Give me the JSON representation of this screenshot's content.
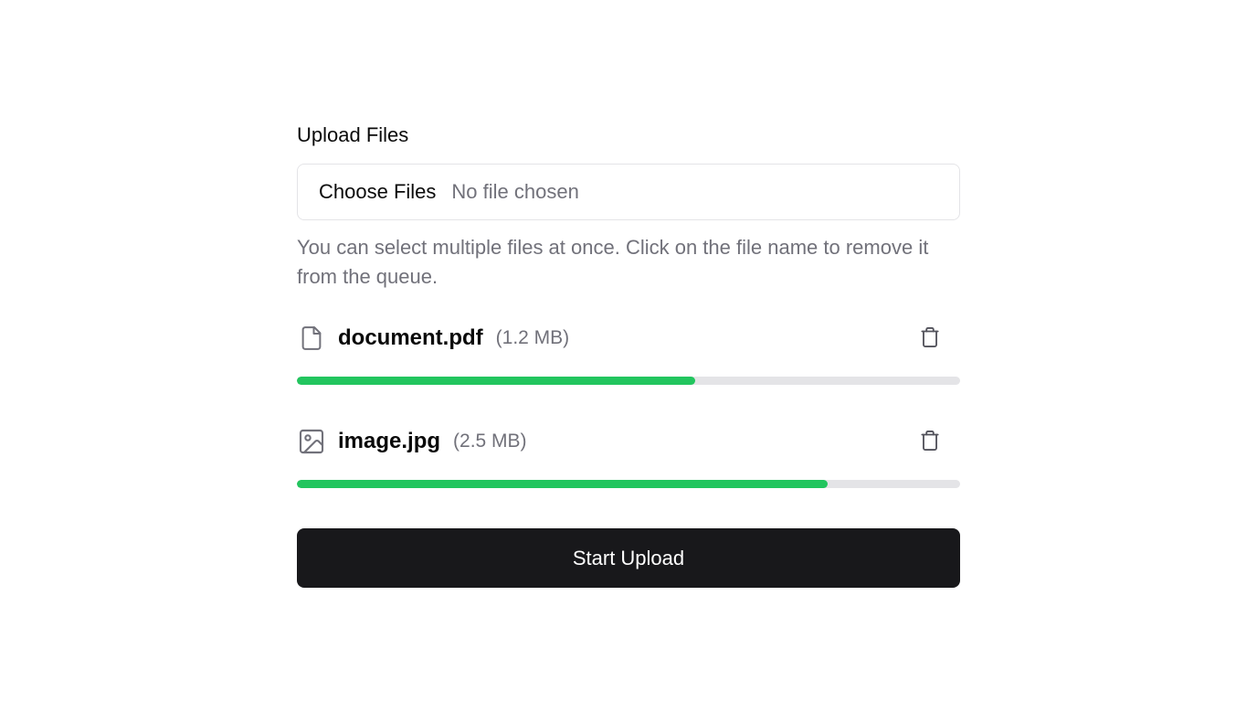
{
  "uploader": {
    "title": "Upload Files",
    "choose_label": "Choose Files",
    "no_file_text": "No file chosen",
    "help_text": "You can select multiple files at once. Click on the file name to remove it from the queue.",
    "files": [
      {
        "name": "document.pdf",
        "size": "(1.2 MB)",
        "icon": "file-icon",
        "progress": 0.6
      },
      {
        "name": "image.jpg",
        "size": "(2.5 MB)",
        "icon": "image-icon",
        "progress": 0.8
      }
    ],
    "start_label": "Start Upload"
  },
  "colors": {
    "progress_fill": "#22c55e",
    "progress_track": "#e4e4e7",
    "button_bg": "#18181b",
    "muted_text": "#71717a",
    "icon": "#71717a"
  }
}
